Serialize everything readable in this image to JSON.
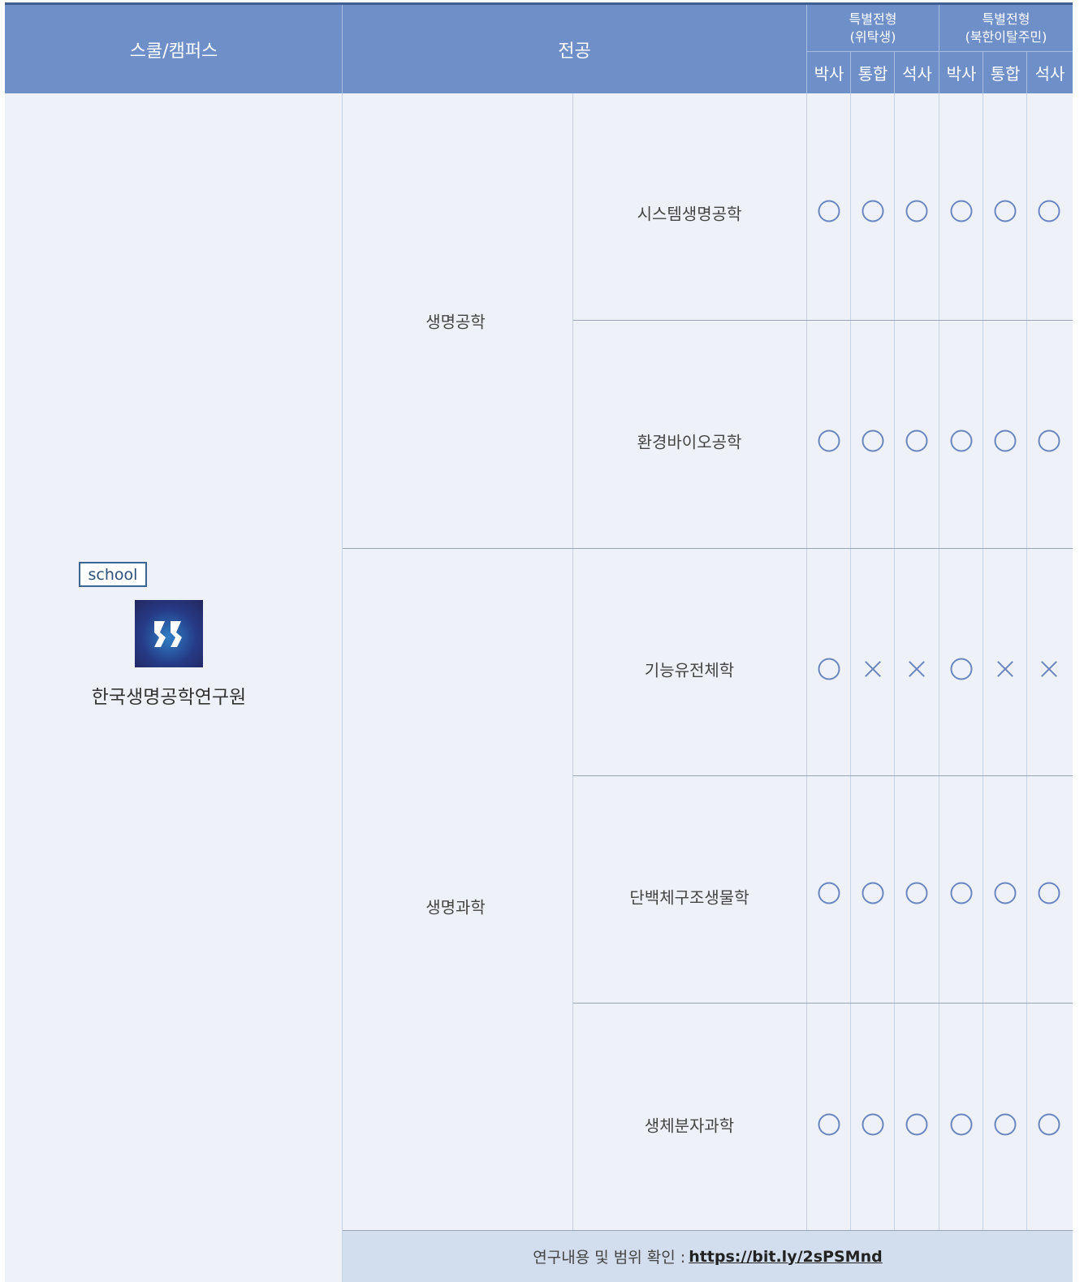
{
  "header": {
    "school_campus": "스쿨/캠퍼스",
    "major": "전공",
    "group1_line1": "특별전형",
    "group1_line2": "(위탁생)",
    "group2_line1": "특별전형",
    "group2_line2": "(북한이탈주민)",
    "columns": [
      "박사",
      "통합",
      "석사",
      "박사",
      "통합",
      "석사"
    ]
  },
  "school": {
    "badge": "school",
    "logo_icon": "kribb-logo-icon",
    "name": "한국생명공학연구원"
  },
  "groups": [
    {
      "name": "생명공학"
    },
    {
      "name": "생명과학"
    }
  ],
  "rows": [
    {
      "major": "시스템생명공학",
      "marks": [
        "O",
        "O",
        "O",
        "O",
        "O",
        "O"
      ]
    },
    {
      "major": "환경바이오공학",
      "marks": [
        "O",
        "O",
        "O",
        "O",
        "O",
        "O"
      ]
    },
    {
      "major": "기능유전체학",
      "marks": [
        "O",
        "X",
        "X",
        "O",
        "X",
        "X"
      ]
    },
    {
      "major": "단백체구조생물학",
      "marks": [
        "O",
        "O",
        "O",
        "O",
        "O",
        "O"
      ]
    },
    {
      "major": "생체분자과학",
      "marks": [
        "O",
        "O",
        "O",
        "O",
        "O",
        "O"
      ]
    }
  ],
  "footer": {
    "label": "연구내용 및 범위 확인 :",
    "link": "https://bit.ly/2sPSMnd"
  },
  "colors": {
    "header_bg": "#6e8fc7",
    "body_bg": "#eef2f8",
    "mark": "#6a86bf",
    "footer_bg": "#d2deee"
  }
}
